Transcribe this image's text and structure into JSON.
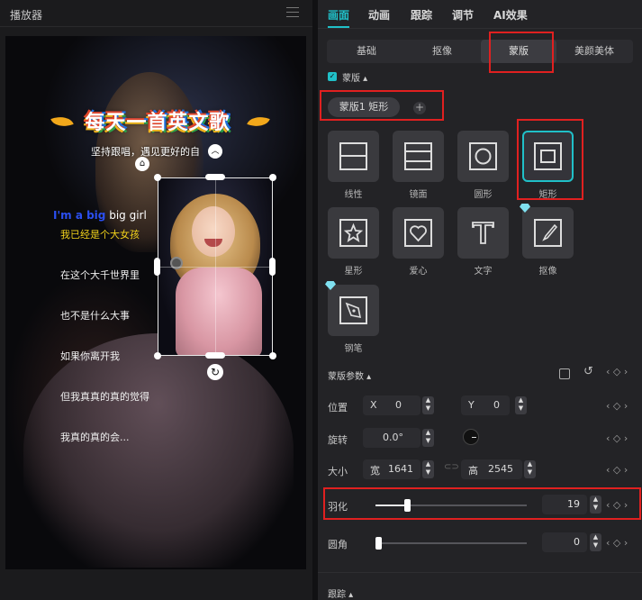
{
  "player": {
    "title": "播放器",
    "song_title": "每天一首英文歌",
    "song_subtitle": "坚持跟唱，遇见更好的自",
    "lyric_en_prefix": "I'm a big",
    "lyric_en_rest": " big girl",
    "lyrics": [
      "我已经是个大女孩",
      "在这个大千世界里",
      "也不是什么大事",
      "如果你离开我",
      "但我真真的真的觉得",
      "我真的真的会..."
    ]
  },
  "top_tabs": [
    "画面",
    "动画",
    "跟踪",
    "调节",
    "AI效果"
  ],
  "sub_tabs": [
    "基础",
    "抠像",
    "蒙版",
    "美颜美体"
  ],
  "mask": {
    "section_label": "蒙版",
    "chip_label": "蒙版1 矩形",
    "shapes": [
      "线性",
      "镜面",
      "圆形",
      "矩形",
      "星形",
      "爱心",
      "文字",
      "抠像",
      "钢笔"
    ]
  },
  "params": {
    "header": "蒙版参数",
    "position_label": "位置",
    "x_label": "X",
    "x_value": "0",
    "y_label": "Y",
    "y_value": "0",
    "rotation_label": "旋转",
    "rotation_value": "0.0°",
    "size_label": "大小",
    "width_label": "宽",
    "width_value": "1641",
    "height_label": "高",
    "height_value": "2545",
    "feather_label": "羽化",
    "feather_value": "19",
    "feather_level": 0.19,
    "radius_label": "圆角",
    "radius_value": "0"
  },
  "tracking_label": "跟踪",
  "colors": {
    "accent": "#20c0c8",
    "highlight": "#e02020",
    "lyric_highlight": "#f2d21b",
    "lyric_en_highlight": "#2b4ff0"
  }
}
